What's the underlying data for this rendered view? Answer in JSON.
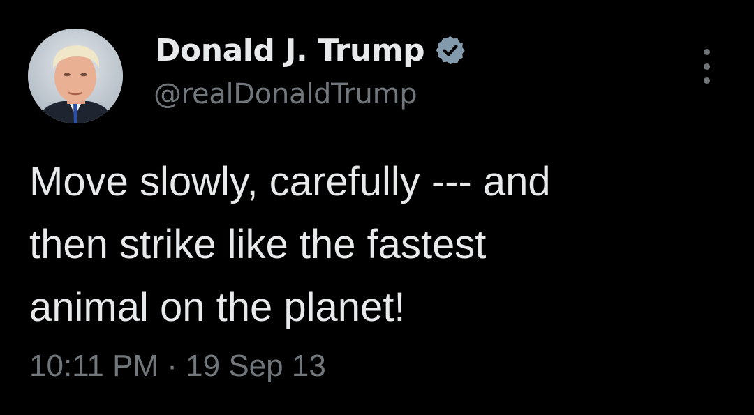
{
  "tweet": {
    "author": {
      "display_name": "Donald J. Trump",
      "handle": "@realDonaldTrump",
      "verified": true,
      "avatar_icon": "profile-photo",
      "verified_icon": "verified-badge-icon"
    },
    "more_icon": "more-options-icon",
    "text": "Move slowly, carefully --- and\nthen strike like the fastest\nanimal on the planet!",
    "timestamp": "10:11 PM · 19 Sep 13"
  },
  "colors": {
    "background": "#000000",
    "primary_text": "#e7e9ea",
    "secondary_text": "#71767b",
    "verified_badge": "#829aab"
  }
}
